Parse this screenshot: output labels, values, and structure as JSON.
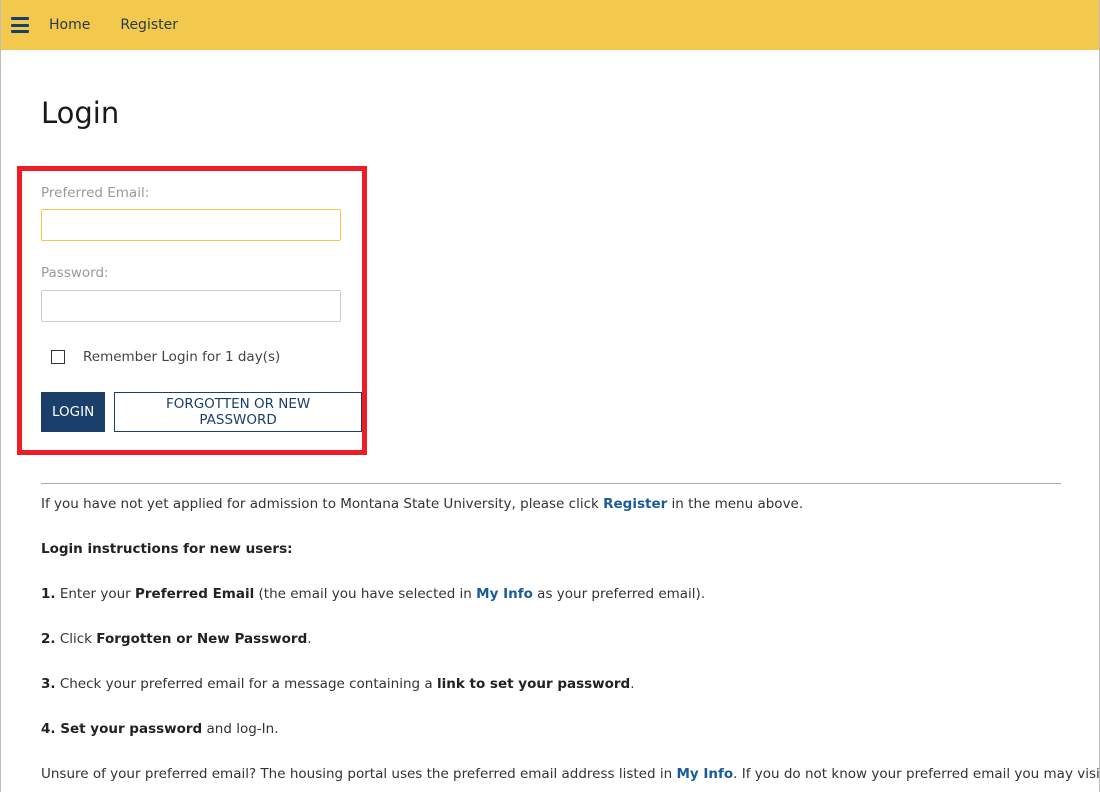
{
  "nav": {
    "menu_icon": "hamburger-menu-icon",
    "home": "Home",
    "register": "Register"
  },
  "page": {
    "title": "Login"
  },
  "form": {
    "email_label": "Preferred Email:",
    "email_value": "",
    "password_label": "Password:",
    "password_value": "",
    "remember_label": "Remember Login for 1 day(s)",
    "login_button": "LOGIN",
    "forgot_button": "FORGOTTEN OR NEW PASSWORD"
  },
  "info": {
    "intro_before": "If you have not yet applied for admission to Montana State University, please click ",
    "intro_link": "Register",
    "intro_after": " in the menu above.",
    "heading": "Login instructions for new users:",
    "step1_num": "1.",
    "step1_a": " Enter your ",
    "step1_bold": "Preferred Email",
    "step1_b": " (the email you have selected in ",
    "step1_link": "My Info",
    "step1_c": " as your preferred email).",
    "step2_num": "2.",
    "step2_a": " Click ",
    "step2_bold": "Forgotten or New Password",
    "step2_b": ".",
    "step3_num": "3.",
    "step3_a": " Check your preferred email for a message containing a ",
    "step3_bold": "link to set your password",
    "step3_b": ".",
    "step4_num": "4.",
    "step4_bold": " Set your password",
    "step4_a": " and log-In.",
    "unsure_before": "Unsure of your preferred email? The housing portal uses the preferred email address listed in ",
    "unsure_link": "My Info",
    "unsure_after": ". If you do not know your preferred email you may visit"
  },
  "colors": {
    "nav_bg": "#f2c94c",
    "primary": "#1b3f6b",
    "highlight_border": "#ee1c25",
    "link": "#1a5c99"
  }
}
